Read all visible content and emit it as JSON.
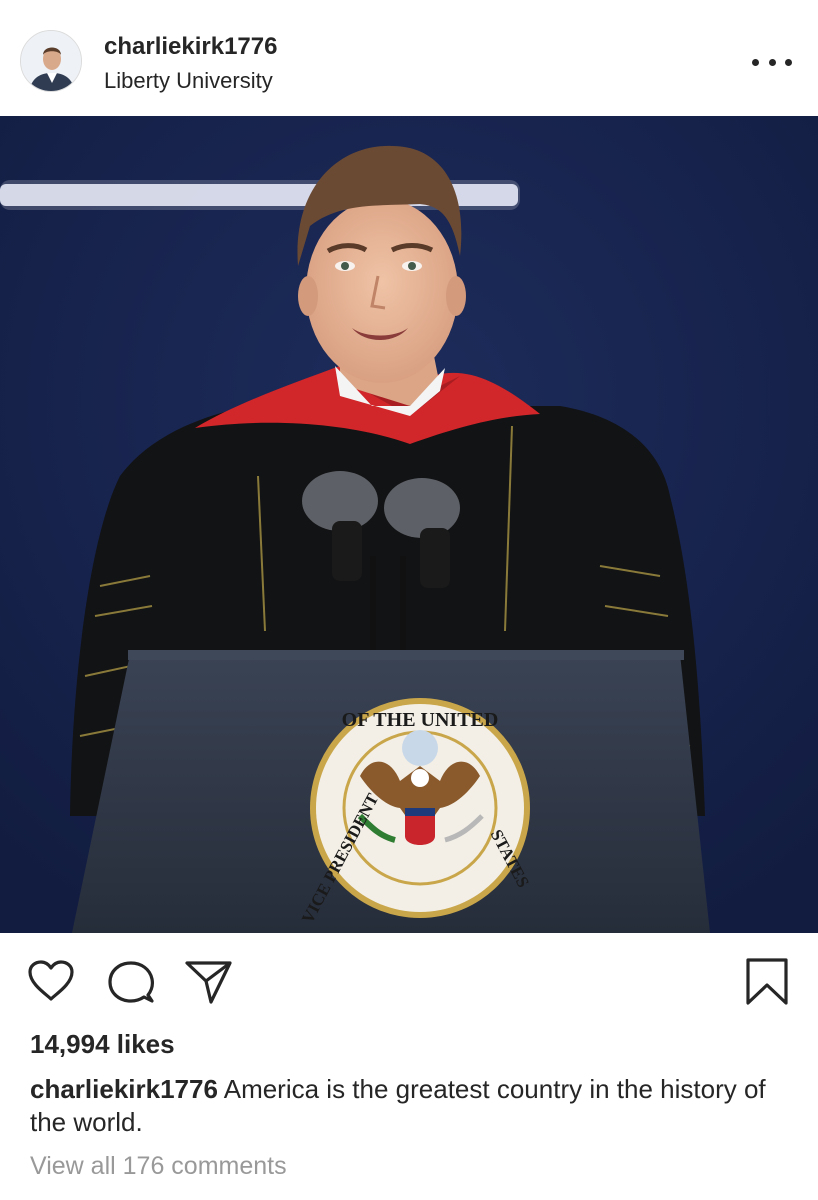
{
  "post": {
    "username": "charliekirk1776",
    "location": "Liberty University",
    "likes": "14,994 likes",
    "caption_user": "charliekirk1776",
    "caption_text": " America is the greatest country in the history of the world.",
    "comments_link": "View all 176 comments"
  },
  "photo": {
    "seal_text_top": "OF THE UNITED",
    "seal_text_left": "VICE PRESIDENT",
    "seal_text_right": "STATES"
  },
  "icons": {
    "more": "more-options-icon",
    "like": "heart-icon",
    "comment": "comment-icon",
    "share": "paper-plane-icon",
    "save": "bookmark-icon"
  },
  "colors": {
    "background": "#ffffff",
    "text": "#262626",
    "muted": "#999999",
    "photo_backdrop": "#17244e",
    "robe": "#121314",
    "hood": "#d1262a",
    "podium": "#2d3544"
  }
}
